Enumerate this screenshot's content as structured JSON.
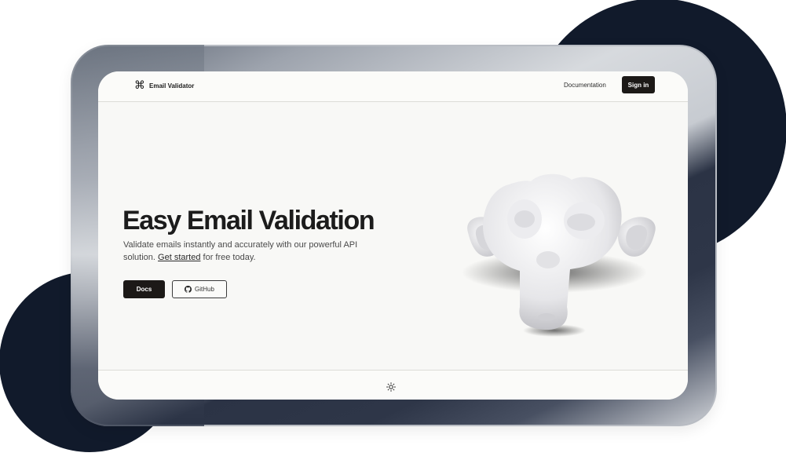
{
  "navbar": {
    "brand_icon": "⌘",
    "brand_name": "Email Validator",
    "documentation_link": "Documentation",
    "sign_in_button": "Sign in"
  },
  "hero": {
    "title": "Easy Email Validation",
    "description_lead": "Validate emails instantly and accurately with our powerful API solution.",
    "cta_link": "Get started",
    "description_tail": "for free today.",
    "docs_button": "Docs",
    "github_button": "GitHub",
    "illustration": "monkey-head-3d-icon"
  },
  "footer": {
    "theme_toggle_icon": "sun-icon"
  },
  "colors": {
    "primary": "#1c1917",
    "page_background": "#f8f8f6",
    "decor_navy": "#111a2b"
  }
}
